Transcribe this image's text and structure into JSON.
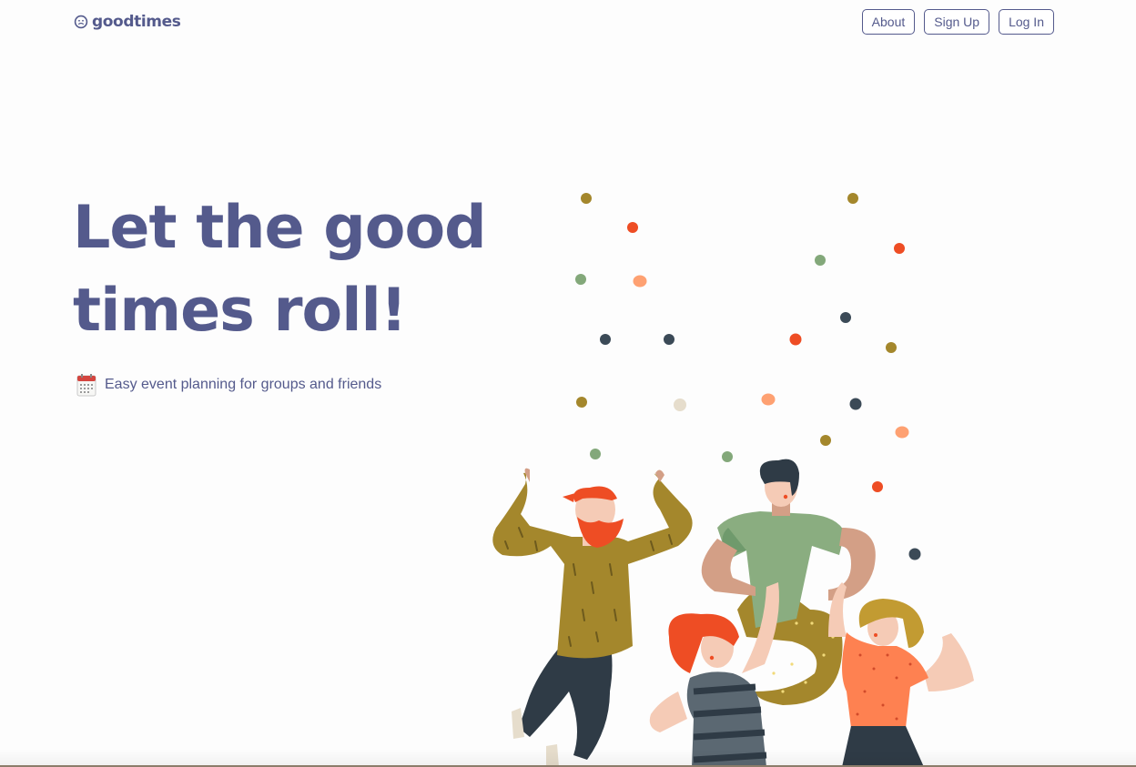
{
  "header": {
    "logo_text": "goodtimes",
    "logo_icon": "smiley-icon",
    "nav": [
      {
        "label": "About"
      },
      {
        "label": "Sign Up"
      },
      {
        "label": "Log In"
      }
    ]
  },
  "hero": {
    "title_line1": "Let the good",
    "title_line2": "times roll!",
    "tagline_icon": "calendar-icon",
    "tagline": "Easy event planning for groups and friends"
  },
  "illustration": {
    "name": "dancing-friends-illustration",
    "confetti_colors": [
      "#a4872c",
      "#ee4d24",
      "#83a87a",
      "#fea172",
      "#3b4a57",
      "#e6ddcc"
    ]
  },
  "colors": {
    "brand": "#545a8c",
    "background": "#fdfdfd"
  }
}
